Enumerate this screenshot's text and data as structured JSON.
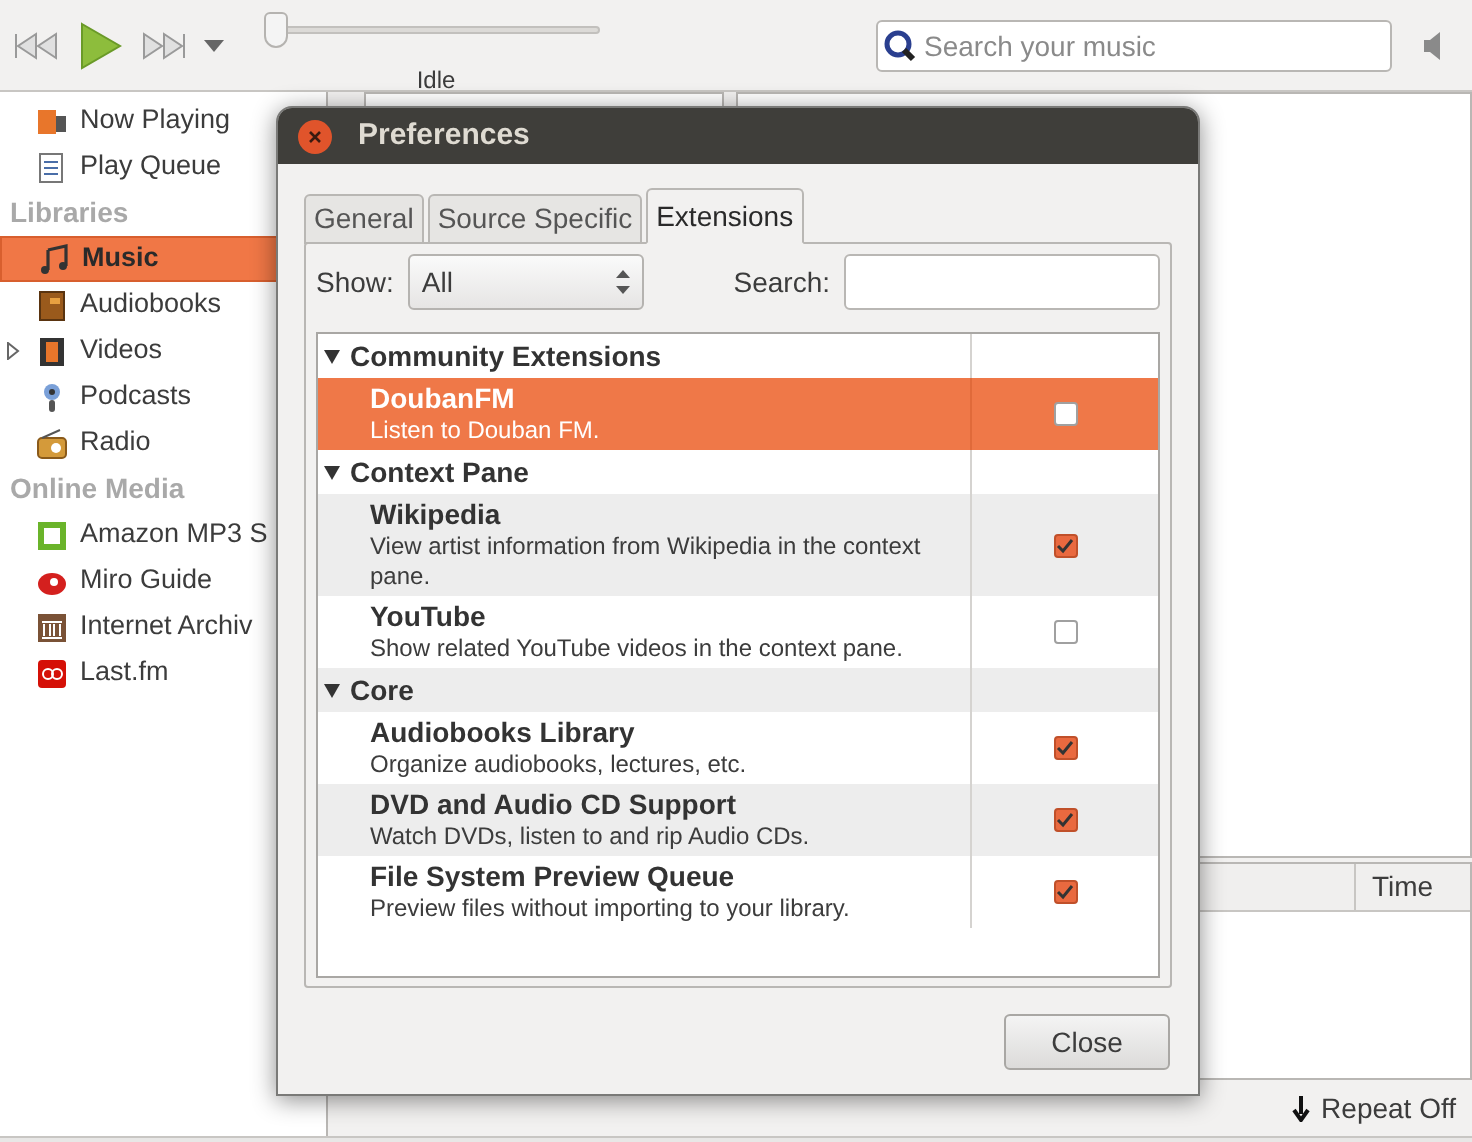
{
  "toolbar": {
    "seek": {
      "level": 0
    },
    "status": "Idle",
    "search": {
      "placeholder": "Search your music"
    }
  },
  "sidebar": {
    "items": [
      {
        "kind": "item",
        "label": "Now Playing",
        "selected": false
      },
      {
        "kind": "item",
        "label": "Play Queue",
        "selected": false
      },
      {
        "kind": "header",
        "label": "Libraries"
      },
      {
        "kind": "item",
        "label": "Music",
        "selected": true
      },
      {
        "kind": "item",
        "label": "Audiobooks",
        "selected": false
      },
      {
        "kind": "item",
        "label": "Videos",
        "selected": false,
        "expanded": false
      },
      {
        "kind": "item",
        "label": "Podcasts",
        "selected": false
      },
      {
        "kind": "item",
        "label": "Radio",
        "selected": false
      },
      {
        "kind": "header",
        "label": "Online Media"
      },
      {
        "kind": "item",
        "label": "Amazon MP3 S",
        "selected": false
      },
      {
        "kind": "item",
        "label": "Miro Guide",
        "selected": false
      },
      {
        "kind": "item",
        "label": "Internet Archiv",
        "selected": false
      },
      {
        "kind": "item",
        "label": "Last.fm",
        "selected": false
      }
    ]
  },
  "track_list": {
    "columns": [
      "Time"
    ]
  },
  "status_bar": {
    "repeat": "Repeat Off"
  },
  "dialog": {
    "title": "Preferences",
    "tabs": [
      {
        "label": "General",
        "selected": false
      },
      {
        "label": "Source Specific",
        "selected": false
      },
      {
        "label": "Extensions",
        "selected": true
      }
    ],
    "show_label": "Show:",
    "show_value": "All",
    "search_label": "Search:",
    "groups": [
      {
        "name": "Community Extensions",
        "expanded": true,
        "extensions": [
          {
            "name": "DoubanFM",
            "description": "Listen to Douban FM.",
            "enabled": false,
            "selected": true
          }
        ]
      },
      {
        "name": "Context Pane",
        "expanded": true,
        "extensions": [
          {
            "name": "Wikipedia",
            "description": "View artist information from Wikipedia in the context pane.",
            "enabled": true,
            "selected": false
          },
          {
            "name": "YouTube",
            "description": "Show related YouTube videos in the context pane.",
            "enabled": false,
            "selected": false
          }
        ]
      },
      {
        "name": "Core",
        "expanded": true,
        "extensions": [
          {
            "name": "Audiobooks Library",
            "description": "Organize audiobooks, lectures, etc.",
            "enabled": true,
            "selected": false
          },
          {
            "name": "DVD and Audio CD Support",
            "description": "Watch DVDs, listen to and rip Audio CDs.",
            "enabled": true,
            "selected": false
          },
          {
            "name": "File System Preview Queue",
            "description": "Preview files without importing to your library.",
            "enabled": true,
            "selected": false
          }
        ]
      }
    ],
    "close": "Close"
  }
}
